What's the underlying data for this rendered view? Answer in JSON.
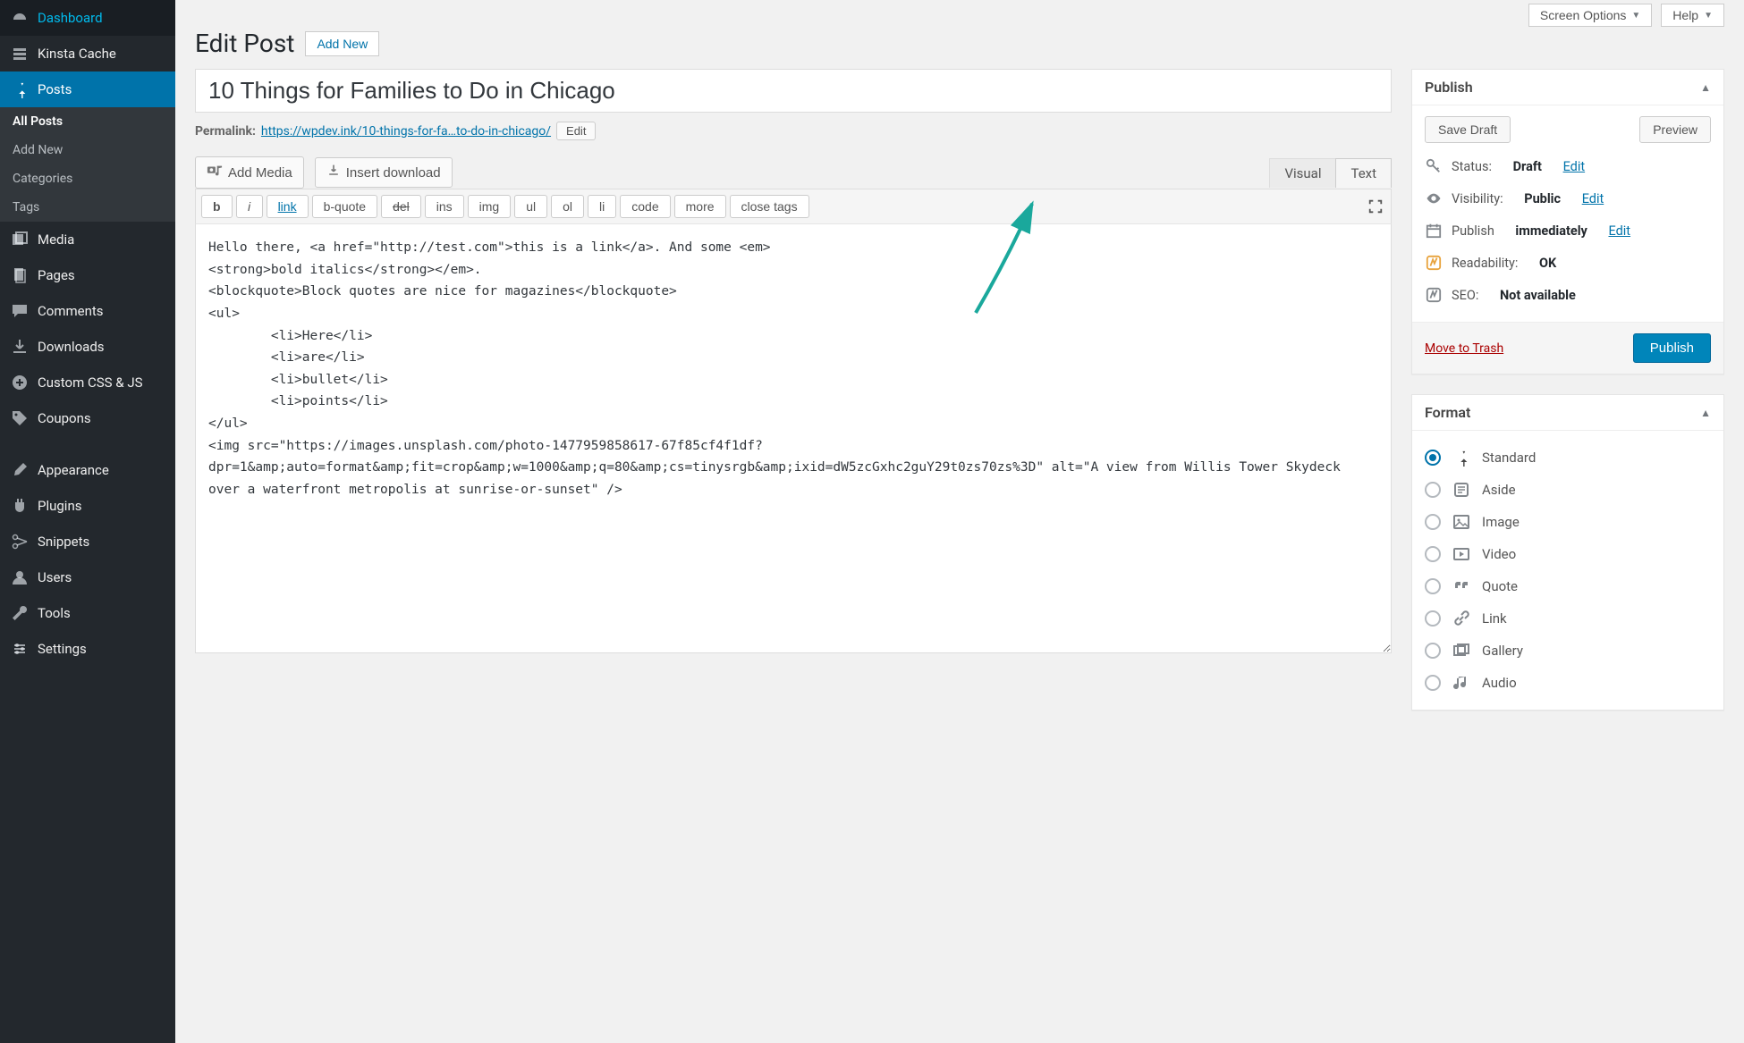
{
  "topbar": {
    "screen_options": "Screen Options",
    "help": "Help"
  },
  "sidebar": {
    "items": [
      {
        "id": "dashboard",
        "label": "Dashboard"
      },
      {
        "id": "kinsta-cache",
        "label": "Kinsta Cache"
      },
      {
        "id": "posts",
        "label": "Posts",
        "active": true,
        "sub": [
          {
            "label": "All Posts",
            "active": true
          },
          {
            "label": "Add New"
          },
          {
            "label": "Categories"
          },
          {
            "label": "Tags"
          }
        ]
      },
      {
        "id": "media",
        "label": "Media"
      },
      {
        "id": "pages",
        "label": "Pages"
      },
      {
        "id": "comments",
        "label": "Comments"
      },
      {
        "id": "downloads",
        "label": "Downloads"
      },
      {
        "id": "custom-css",
        "label": "Custom CSS & JS"
      },
      {
        "id": "coupons",
        "label": "Coupons"
      },
      {
        "id": "appearance",
        "label": "Appearance"
      },
      {
        "id": "plugins",
        "label": "Plugins"
      },
      {
        "id": "snippets",
        "label": "Snippets"
      },
      {
        "id": "users",
        "label": "Users"
      },
      {
        "id": "tools",
        "label": "Tools"
      },
      {
        "id": "settings",
        "label": "Settings"
      }
    ]
  },
  "page": {
    "heading": "Edit Post",
    "add_new": "Add New",
    "title_value": "10 Things for Families to Do in Chicago",
    "permalink_label": "Permalink:",
    "permalink_base": "https://wpdev.ink/",
    "permalink_slug": "10-things-for-fa…to-do-in-chicago/",
    "permalink_edit": "Edit"
  },
  "editor": {
    "add_media": "Add Media",
    "insert_download": "Insert download",
    "tab_visual": "Visual",
    "tab_text": "Text",
    "quicktags": [
      "b",
      "i",
      "link",
      "b-quote",
      "del",
      "ins",
      "img",
      "ul",
      "ol",
      "li",
      "code",
      "more",
      "close tags"
    ],
    "content": "Hello there, <a href=\"http://test.com\">this is a link</a>. And some <em>\n<strong>bold italics</strong></em>.\n<blockquote>Block quotes are nice for magazines</blockquote>\n<ul>\n        <li>Here</li>\n        <li>are</li>\n        <li>bullet</li>\n        <li>points</li>\n</ul>\n<img src=\"https://images.unsplash.com/photo-1477959858617-67f85cf4f1df?dpr=1&amp;auto=format&amp;fit=crop&amp;w=1000&amp;q=80&amp;cs=tinysrgb&amp;ixid=dW5zcGxhc2guY29t0zs70zs%3D\" alt=\"A view from Willis Tower Skydeck over a waterfront metropolis at sunrise-or-sunset\" />"
  },
  "publish": {
    "title": "Publish",
    "save_draft": "Save Draft",
    "preview": "Preview",
    "status_label": "Status:",
    "status_value": "Draft",
    "visibility_label": "Visibility:",
    "visibility_value": "Public",
    "publish_label": "Publish",
    "publish_value": "immediately",
    "readability_label": "Readability:",
    "readability_value": "OK",
    "seo_label": "SEO:",
    "seo_value": "Not available",
    "edit": "Edit",
    "trash": "Move to Trash",
    "publish_btn": "Publish"
  },
  "format": {
    "title": "Format",
    "items": [
      {
        "id": "standard",
        "label": "Standard",
        "checked": true
      },
      {
        "id": "aside",
        "label": "Aside"
      },
      {
        "id": "image",
        "label": "Image"
      },
      {
        "id": "video",
        "label": "Video"
      },
      {
        "id": "quote",
        "label": "Quote"
      },
      {
        "id": "link",
        "label": "Link"
      },
      {
        "id": "gallery",
        "label": "Gallery"
      },
      {
        "id": "audio",
        "label": "Audio"
      }
    ]
  }
}
